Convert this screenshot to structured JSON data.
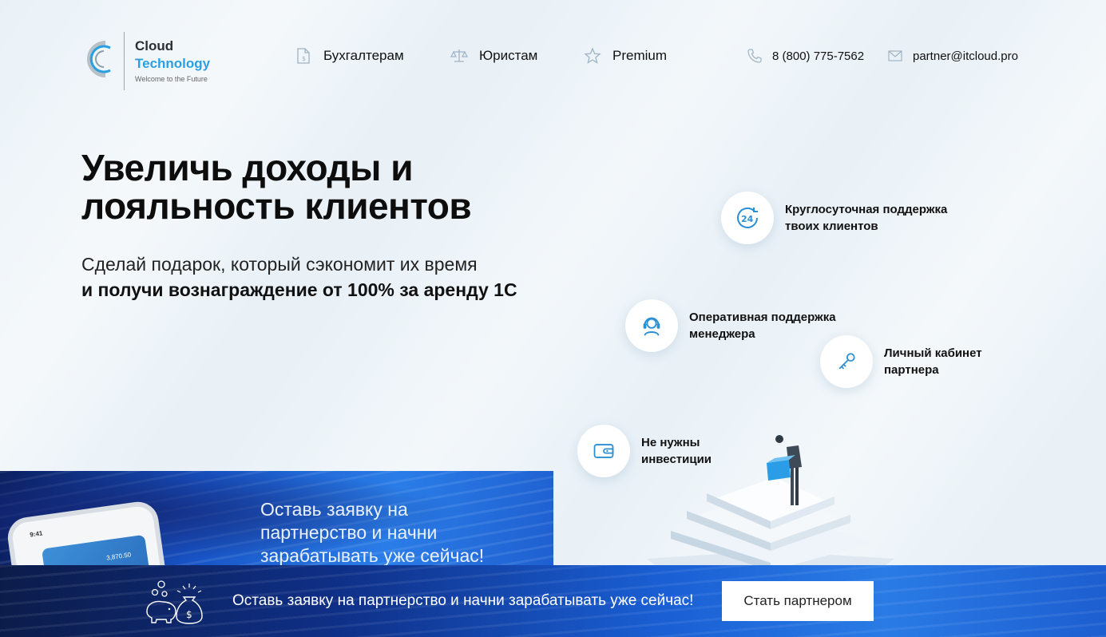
{
  "brand": {
    "name_line1": "Cloud",
    "name_line2": "Technology",
    "tagline": "Welcome to the Future",
    "accent_color": "#2aa0e0"
  },
  "nav": {
    "items": [
      {
        "label": "Бухгалтерам",
        "icon": "document-icon"
      },
      {
        "label": "Юристам",
        "icon": "scales-icon"
      },
      {
        "label": "Premium",
        "icon": "star-icon"
      }
    ]
  },
  "contacts": {
    "phone": "8 (800) 775-7562",
    "email": "partner@itcloud.pro"
  },
  "hero": {
    "title": "Увеличь доходы и лояльность клиентов",
    "subtitle_line1": "Сделай подарок, который сэкономит их время",
    "subtitle_line2": "и получи вознаграждение от 100% за аренду 1С"
  },
  "features": [
    {
      "label": "Круглосуточная поддержка твоих клиентов",
      "icon": "24h-support-icon"
    },
    {
      "label": "Оперативная поддержка менеджера",
      "icon": "headset-operator-icon"
    },
    {
      "label": "Личный кабинет партнера",
      "icon": "key-icon"
    },
    {
      "label": "Не нужны инвестиции",
      "icon": "wallet-icon"
    }
  ],
  "promo_card": {
    "text": "Оставь заявку на партнерство и начни зарабатывать уже сейчас!",
    "phone_time": "9:41",
    "phone_balance": "3,870.50"
  },
  "cta": {
    "text": "Оставь заявку на партнерство и начни зарабатывать уже сейчас!",
    "button_label": "Стать партнером",
    "icons": [
      "piggy-bank-icon",
      "money-bag-icon"
    ]
  }
}
